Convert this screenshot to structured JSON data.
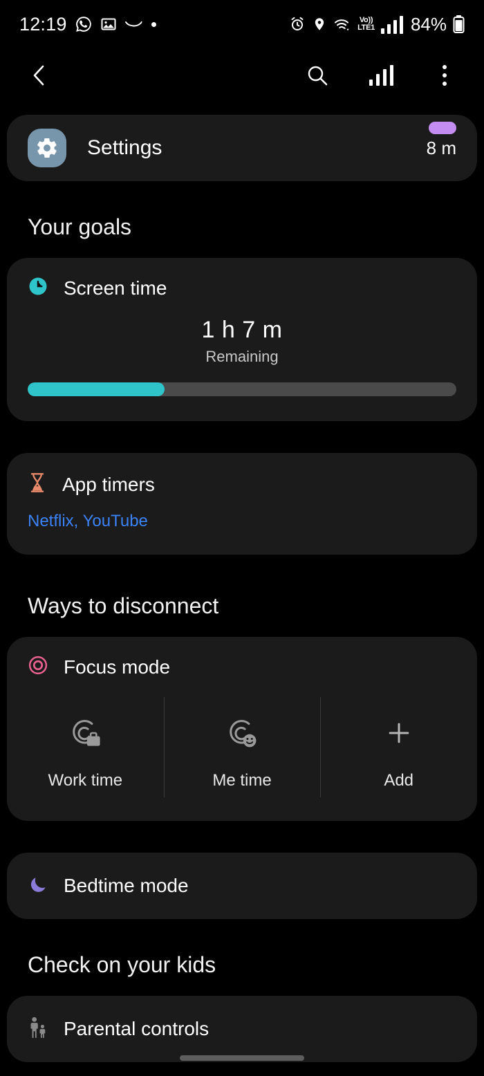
{
  "statusbar": {
    "time": "12:19",
    "left_icons": [
      "whatsapp-icon",
      "gallery-icon",
      "amazon-icon",
      "dot-icon"
    ],
    "network_label_top": "Vo))",
    "network_label_bottom": "LTE1",
    "battery_percent": "84%",
    "right_icons": [
      "alarm-icon",
      "location-icon",
      "wifi-icon",
      "signal-icon",
      "battery-icon"
    ]
  },
  "actionbar": {
    "back_icon": "back-chevron-icon",
    "search_icon": "search-icon",
    "chart_icon": "bar-chart-icon",
    "menu_icon": "more-options-icon"
  },
  "settings_card": {
    "icon": "gear-icon",
    "name": "Settings",
    "time": "8 m",
    "badge_color": "#c38cf0",
    "icon_bg": "#7796ac"
  },
  "sections": {
    "goals_title": "Your goals",
    "disconnect_title": "Ways to disconnect",
    "kids_title": "Check on your kids"
  },
  "screen_time": {
    "icon": "clock-icon",
    "icon_color": "#2fc4c9",
    "label": "Screen time",
    "value": "1 h 7 m",
    "sub": "Remaining",
    "progress_percent": 32,
    "fill_color": "#2fc4c9",
    "track_color": "#4a4a4a"
  },
  "app_timers": {
    "icon": "hourglass-icon",
    "icon_color": "#e8896b",
    "label": "App timers",
    "apps": "Netflix, YouTube",
    "apps_color": "#3b82f6"
  },
  "focus_mode": {
    "icon": "target-icon",
    "icon_color": "#e8608f",
    "label": "Focus mode",
    "options": [
      {
        "icon": "work-focus-icon",
        "label": "Work time"
      },
      {
        "icon": "me-time-focus-icon",
        "label": "Me time"
      },
      {
        "icon": "plus-icon",
        "label": "Add"
      }
    ]
  },
  "bedtime_mode": {
    "icon": "moon-icon",
    "icon_color": "#8b7bd8",
    "label": "Bedtime mode"
  },
  "parental_controls": {
    "icon": "parent-child-icon",
    "icon_color": "#8a8a8a",
    "label": "Parental controls"
  }
}
